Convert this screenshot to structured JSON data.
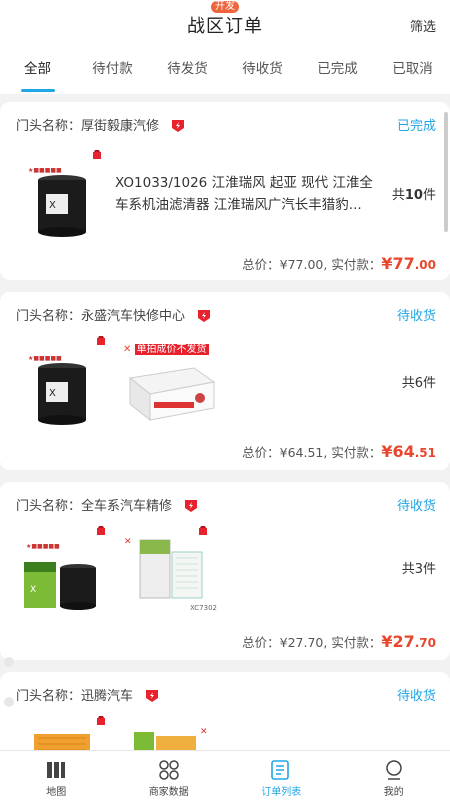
{
  "header": {
    "title": "战区订单",
    "dev_badge": "开发",
    "filter_label": "筛选"
  },
  "tabs": [
    {
      "label": "全部",
      "active": true
    },
    {
      "label": "待付款",
      "active": false
    },
    {
      "label": "待发货",
      "active": false
    },
    {
      "label": "待收货",
      "active": false
    },
    {
      "label": "已完成",
      "active": false
    },
    {
      "label": "已取消",
      "active": false
    }
  ],
  "orders": [
    {
      "store_label": "门头名称：厚街毅康汽修",
      "status": "已完成",
      "product_name": "XO1033/1026 江淮瑞风 起亚 现代 江淮全车系机油滤清器 江淮瑞风广汽长丰猎豹...",
      "count_prefix": "共",
      "count": "10",
      "count_suffix": "件",
      "total_text": "总价：¥77.00, 实付款：",
      "pay_symbol": "¥",
      "pay_int": "77",
      "pay_dec": ".00"
    },
    {
      "store_label": "门头名称：永盛汽车快修中心",
      "status": "待收货",
      "promo_text": "单拍成价不发货",
      "count_prefix": "共",
      "count": "6",
      "count_suffix": "件",
      "total_text": "总价：¥64.51, 实付款：",
      "pay_symbol": "¥",
      "pay_int": "64",
      "pay_dec": ".51"
    },
    {
      "store_label": "门头名称：全车系汽车精修",
      "status": "待收货",
      "filter_code": "XC7302",
      "count_prefix": "共",
      "count": "3",
      "count_suffix": "件",
      "total_text": "总价：¥27.70, 实付款：",
      "pay_symbol": "¥",
      "pay_int": "27",
      "pay_dec": ".70"
    },
    {
      "store_label": "门头名称：迅腾汽车",
      "status": "待收货"
    }
  ],
  "bottom_nav": [
    {
      "label": "地图",
      "icon": "map-icon",
      "active": false
    },
    {
      "label": "商家数据",
      "icon": "grid-icon",
      "active": false
    },
    {
      "label": "订单列表",
      "icon": "list-icon",
      "active": true
    },
    {
      "label": "我的",
      "icon": "user-icon",
      "active": false
    }
  ],
  "colors": {
    "accent": "#21a6e6",
    "price": "#e8472e",
    "badge": "#f0643c"
  }
}
